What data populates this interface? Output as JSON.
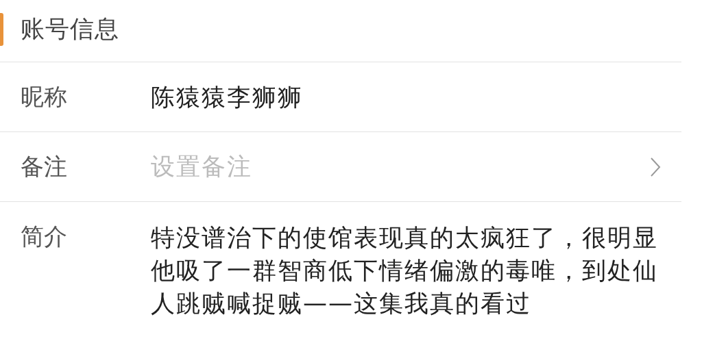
{
  "section": {
    "title": "账号信息"
  },
  "rows": [
    {
      "kind": "value",
      "label": "昵称",
      "value": "陈猿猿李狮狮"
    },
    {
      "kind": "link",
      "label": "备注",
      "placeholder": "设置备注"
    },
    {
      "kind": "value",
      "label": "简介",
      "value": "特没谱治下的使馆表现真的太疯狂了，很明显他吸了一群智商低下情绪偏激的毒唯，到处仙人跳贼喊捉贼——这集我真的看过"
    }
  ]
}
